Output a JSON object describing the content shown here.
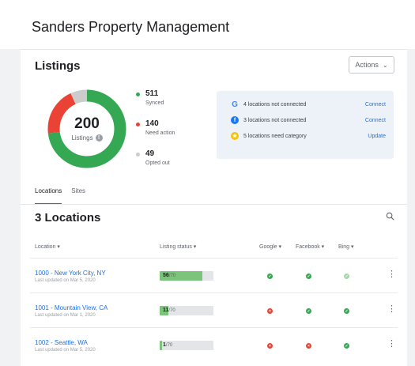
{
  "app": {
    "title": "Sanders Property Management"
  },
  "summary": {
    "title": "Listings",
    "actions_label": "Actions",
    "total": "200",
    "total_label": "Listings",
    "legend": [
      {
        "value": "511",
        "label": "Synced",
        "color": "#34a853"
      },
      {
        "value": "140",
        "label": "Need action",
        "color": "#ea4335"
      },
      {
        "value": "49",
        "label": "Opted out",
        "color": "#cccccc"
      }
    ],
    "chart_data": {
      "type": "pie",
      "categories": [
        "Synced",
        "Need action",
        "Opted out"
      ],
      "values": [
        511,
        140,
        49
      ]
    },
    "notices": [
      {
        "icon": "google-icon",
        "text": "4 locations not connected",
        "action": "Connect"
      },
      {
        "icon": "facebook-icon",
        "text": "3 locations not connected",
        "action": "Connect"
      },
      {
        "icon": "category-icon",
        "text": "5 locations need category",
        "action": "Update"
      }
    ]
  },
  "tabs": [
    {
      "label": "Locations",
      "active": true
    },
    {
      "label": "Sites",
      "active": false
    }
  ],
  "locations": {
    "title": "3 Locations",
    "columns": {
      "location": "Location ▾",
      "status": "Listing status ▾",
      "google": "Google ▾",
      "facebook": "Facebook ▾",
      "bing": "Bing ▾"
    },
    "rows": [
      {
        "name": "1000 - New York City, NY",
        "updated": "Last updated on Mar 5, 2020",
        "synced": "56",
        "total": "/70",
        "progress": 0.8,
        "google": "ok",
        "facebook": "ok",
        "bing": "ok-light"
      },
      {
        "name": "1001 - Mountain View, CA",
        "updated": "Last updated on Mar 1, 2020",
        "synced": "11",
        "total": "/70",
        "progress": 0.16,
        "google": "err",
        "facebook": "ok",
        "bing": "ok"
      },
      {
        "name": "1002 - Seattle, WA",
        "updated": "Last updated on Mar 5, 2020",
        "synced": "1",
        "total": "/70",
        "progress": 0.03,
        "google": "err",
        "facebook": "err",
        "bing": "ok"
      }
    ]
  }
}
